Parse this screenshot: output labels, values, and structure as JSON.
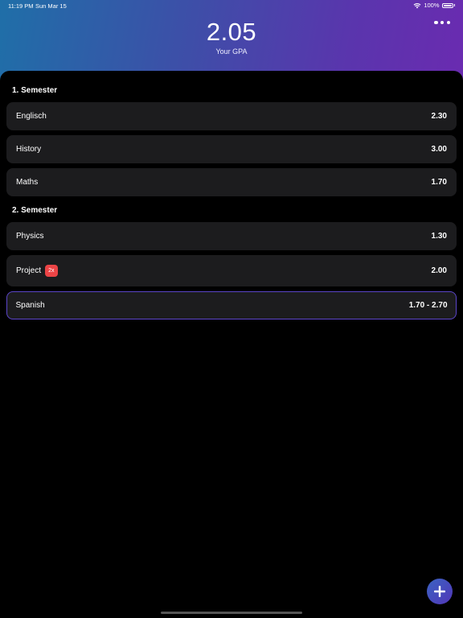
{
  "status": {
    "time": "11:19 PM",
    "date": "Sun Mar 15",
    "battery": "100%",
    "battery_level": 1.0,
    "wifi_icon": "wifi-icon"
  },
  "header": {
    "gpa": "2.05",
    "gpa_label": "Your GPA",
    "more_icon": "ellipsis-icon"
  },
  "colors": {
    "gradient_start": "#1f6fa8",
    "gradient_end": "#6a2bb0",
    "row_bg": "#1c1c1e",
    "badge": "#ec4446",
    "selected_border": "#5b45c8"
  },
  "sections": [
    {
      "title": "1. Semester",
      "courses": [
        {
          "name": "Englisch",
          "grade": "2.30"
        },
        {
          "name": "History",
          "grade": "3.00"
        },
        {
          "name": "Maths",
          "grade": "1.70"
        }
      ]
    },
    {
      "title": "2. Semester",
      "courses": [
        {
          "name": "Physics",
          "grade": "1.30"
        },
        {
          "name": "Project",
          "badge": "2x",
          "grade": "2.00"
        },
        {
          "name": "Spanish",
          "grade": "1.70 - 2.70",
          "selected": true
        }
      ]
    }
  ],
  "fab": {
    "icon": "plus-icon"
  }
}
